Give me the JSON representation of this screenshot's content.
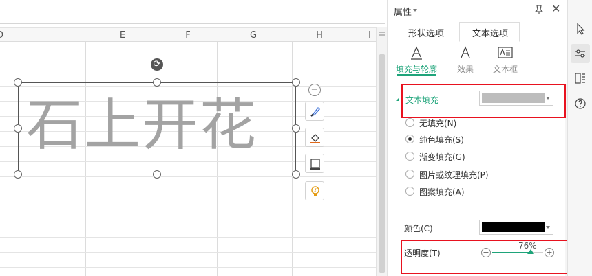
{
  "sheet": {
    "columns": [
      "D",
      "E",
      "F",
      "G",
      "H",
      "I"
    ],
    "wordart_text": "石上开花"
  },
  "panel": {
    "title": "属性",
    "tabs": [
      {
        "label": "形状选项",
        "active": false
      },
      {
        "label": "文本选项",
        "active": true
      }
    ],
    "subtabs": [
      {
        "label": "填充与轮廓",
        "active": true
      },
      {
        "label": "效果",
        "active": false
      },
      {
        "label": "文本框",
        "active": false
      }
    ],
    "section_title": "文本填充",
    "fill_color": "#bdbdbd",
    "fill_options": [
      {
        "label": "无填充(N)",
        "selected": false
      },
      {
        "label": "纯色填充(S)",
        "selected": true
      },
      {
        "label": "渐变填充(G)",
        "selected": false
      },
      {
        "label": "图片或纹理填充(P)",
        "selected": false
      },
      {
        "label": "图案填充(A)",
        "selected": false
      }
    ],
    "color_label": "颜色(C)",
    "color_value": "#000000",
    "transparency_label": "透明度(T)",
    "transparency_value": "76%",
    "transparency_percent": 76
  },
  "colors": {
    "accent": "#1ea47a",
    "annotation": "#e8121f"
  }
}
